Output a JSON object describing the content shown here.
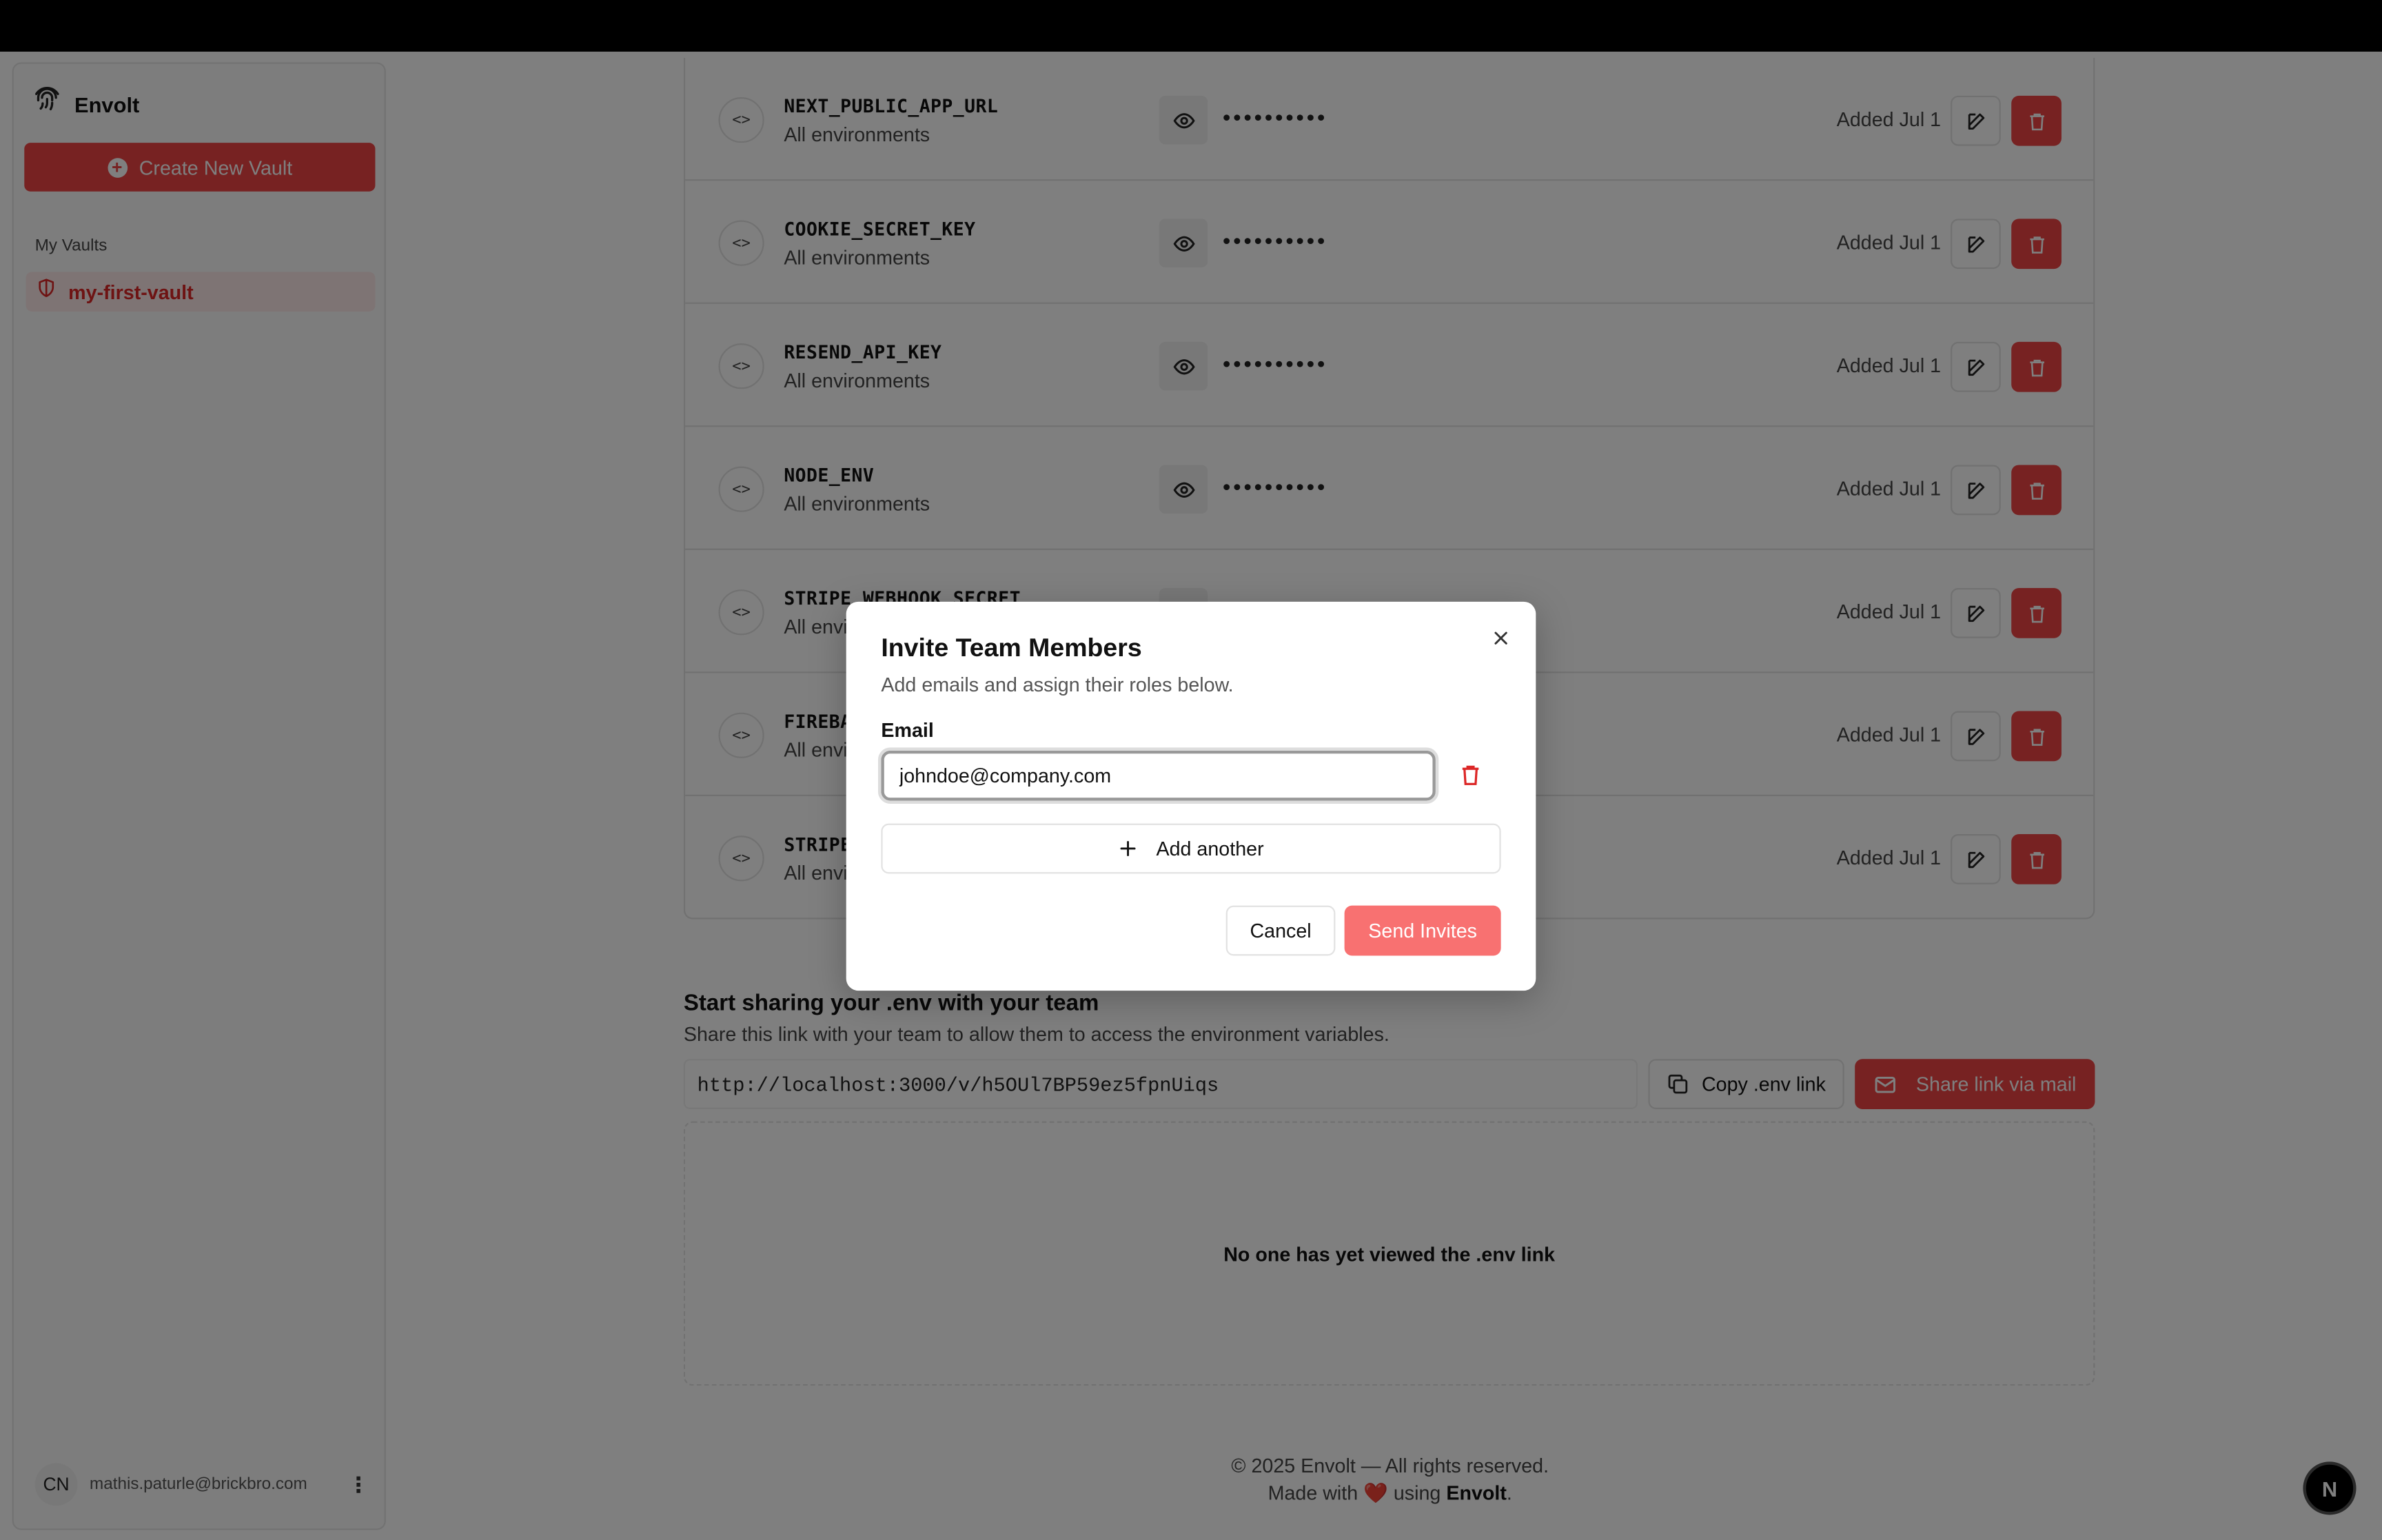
{
  "app": {
    "name": "Envolt"
  },
  "sidebar": {
    "create_label": "Create New Vault",
    "vaults_heading": "My Vaults",
    "vaults": [
      {
        "label": "my-first-vault",
        "active": true
      }
    ],
    "user": {
      "initials": "CN",
      "email": "mathis.paturle@brickbro.com"
    }
  },
  "secrets": [
    {
      "key": "NEXT_PUBLIC_APP_URL",
      "env": "All environments",
      "masked": "••••••••••",
      "added": "Added Jul 1"
    },
    {
      "key": "COOKIE_SECRET_KEY",
      "env": "All environments",
      "masked": "••••••••••",
      "added": "Added Jul 1"
    },
    {
      "key": "RESEND_API_KEY",
      "env": "All environments",
      "masked": "••••••••••",
      "added": "Added Jul 1"
    },
    {
      "key": "NODE_ENV",
      "env": "All environments",
      "masked": "••••••••••",
      "added": "Added Jul 1"
    },
    {
      "key": "STRIPE_WEBHOOK_SECRET",
      "env": "All environments",
      "masked": "••••••••••",
      "added": "Added Jul 1"
    },
    {
      "key": "FIREBASE",
      "env": "All environments",
      "masked": "••••••••••",
      "added": "Added Jul 1"
    },
    {
      "key": "STRIPE",
      "env": "All environments",
      "masked": "••••••••••",
      "added": "Added Jul 1"
    }
  ],
  "share": {
    "title": "Start sharing your .env with your team",
    "description": "Share this link with your team to allow them to access the environment variables.",
    "link": "http://localhost:3000/v/h5OUl7BP59ez5fpnUiqs",
    "copy_label": "Copy .env link",
    "mail_label": "Share link via mail",
    "views_empty": "No one has yet viewed the .env link"
  },
  "footer": {
    "copyright": "© 2025 Envolt — All rights reserved.",
    "made_prefix": "Made with",
    "heart": "❤️",
    "made_middle": "using",
    "made_brand": "Envolt",
    "made_suffix": "."
  },
  "corner_badge": "N",
  "modal": {
    "title": "Invite Team Members",
    "description": "Add emails and assign their roles below.",
    "email_label": "Email",
    "email_value": "johndoe@company.com",
    "add_another_label": "Add another",
    "cancel_label": "Cancel",
    "send_label": "Send Invites"
  },
  "colors": {
    "accent": "#ef4444",
    "accent_soft": "#f87171",
    "overlay": "rgba(0,0,0,0.5)",
    "topbar": "#000000"
  },
  "icons": {
    "brand": "fingerprint-icon",
    "create": "plus-circle-icon",
    "vault": "shield-icon",
    "secret": "code-icon",
    "reveal": "eye-icon",
    "edit": "edit-icon",
    "delete": "trash-icon",
    "copy": "copy-icon",
    "mail": "mail-icon",
    "close": "close-icon",
    "add": "plus-icon",
    "menu": "kebab-icon"
  }
}
